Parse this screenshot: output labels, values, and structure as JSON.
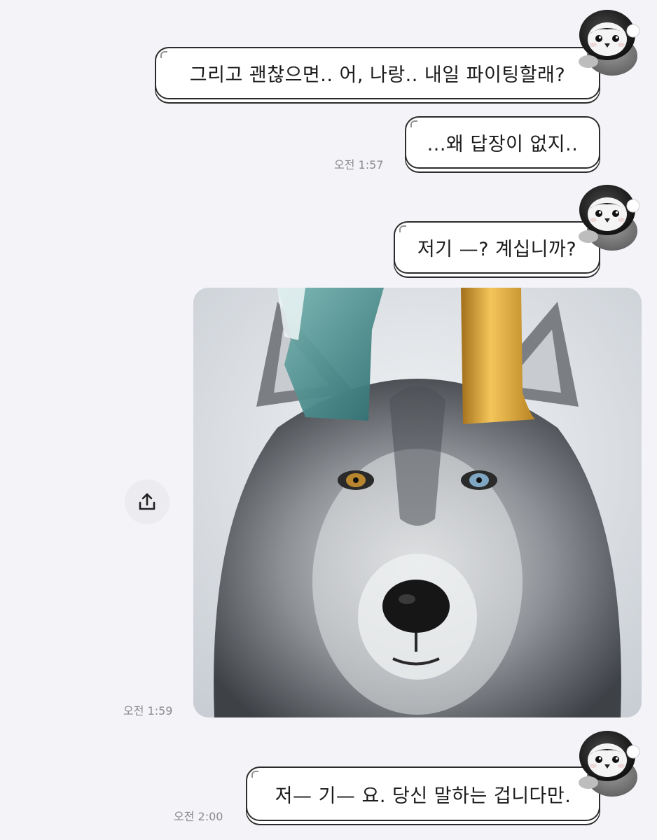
{
  "messages": [
    {
      "text": "그리고 괜찮으면.. 어, 나랑.. 내일 파이팅할래?"
    },
    {
      "text": "...왜 답장이 없지..",
      "time": "오전 1:57"
    },
    {
      "text": "저기 —? 계십니까?"
    },
    {
      "time": "오전 1:59"
    },
    {
      "text": "저— 기— 요. 당신 말하는 겁니다만.",
      "time": "오전 2:00"
    }
  ],
  "icons": {
    "avatar": "penguin-sticker",
    "share": "share-icon"
  },
  "colors": {
    "background": "#f3f3f8",
    "bubble": "#ffffff",
    "outline": "#2c2c2c",
    "timestamp": "#8a8a8f"
  }
}
